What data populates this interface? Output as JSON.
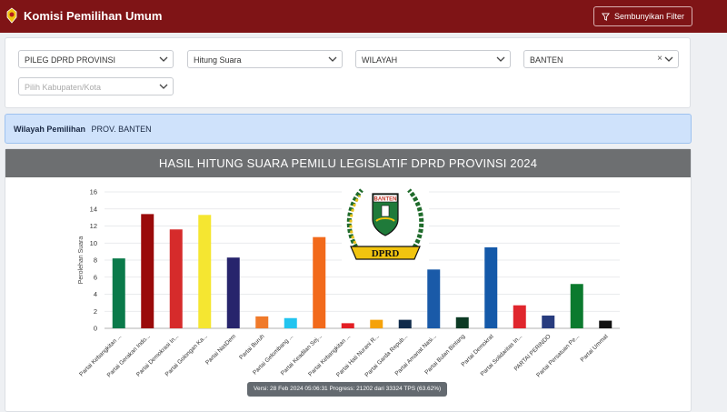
{
  "header": {
    "app_title": "Komisi Pemilihan Umum",
    "filter_button": "Sembunyikan Filter",
    "bg_color": "#7f1416"
  },
  "filters": {
    "jenis": "PILEG DPRD PROVINSI",
    "metode": "Hitung Suara",
    "level": "WILAYAH",
    "provinsi": "BANTEN",
    "kabupaten_placeholder": "Pilih Kabupaten/Kota"
  },
  "wilayah": {
    "label": "Wilayah Pemilihan",
    "value": "PROV. BANTEN"
  },
  "chart_header": "HASIL HITUNG SUARA PEMILU LEGISLATIF DPRD PROVINSI 2024",
  "emblem": {
    "top_text": "BANTEN",
    "bottom_text": "DPRD",
    "icon": "dprd-banten-emblem"
  },
  "tooltip": "Versi: 28 Feb 2024 05:06:31 Progress: 21202 dari 33324 TPS (63.62%)",
  "chart_data": {
    "type": "bar",
    "title": "",
    "xlabel": "",
    "ylabel": "Perolehan Suara",
    "ylim": [
      0,
      16
    ],
    "yticks": [
      0,
      2,
      4,
      6,
      8,
      10,
      12,
      14,
      16
    ],
    "grid": true,
    "categories": [
      "Partai Kebangkitan ...",
      "Partai Gerakan Indo...",
      "Partai Demokrasi In...",
      "Partai Golongan Ka...",
      "Partai NasDem",
      "Partai Buruh",
      "Partai Gelombang ...",
      "Partai Keadilan Sej...",
      "Partai Kebangkitan ...",
      "Partai Hati Nurani R...",
      "Partai Garda Repub...",
      "Partai Amanat Nasi...",
      "Partai Bulan Bintang",
      "Partai Demokrat",
      "Partai Solidaritas In...",
      "PARTAI PERINDO",
      "Partai Persatuan Pe...",
      "Partai Ummat"
    ],
    "values": [
      8.2,
      13.4,
      11.6,
      13.3,
      8.3,
      1.4,
      1.2,
      10.7,
      0.6,
      1.0,
      1.0,
      6.9,
      1.3,
      9.5,
      2.7,
      1.5,
      5.2,
      0.9
    ],
    "colors": [
      "#0a7a4a",
      "#9a0a0a",
      "#d62b2b",
      "#f5e631",
      "#27246c",
      "#f07a2a",
      "#22c4ef",
      "#f26a1b",
      "#e31e24",
      "#f5a20a",
      "#0f2a4a",
      "#1a5aa8",
      "#0c3a24",
      "#1459a9",
      "#e0262d",
      "#283c7e",
      "#0b7a2e",
      "#111111"
    ]
  }
}
